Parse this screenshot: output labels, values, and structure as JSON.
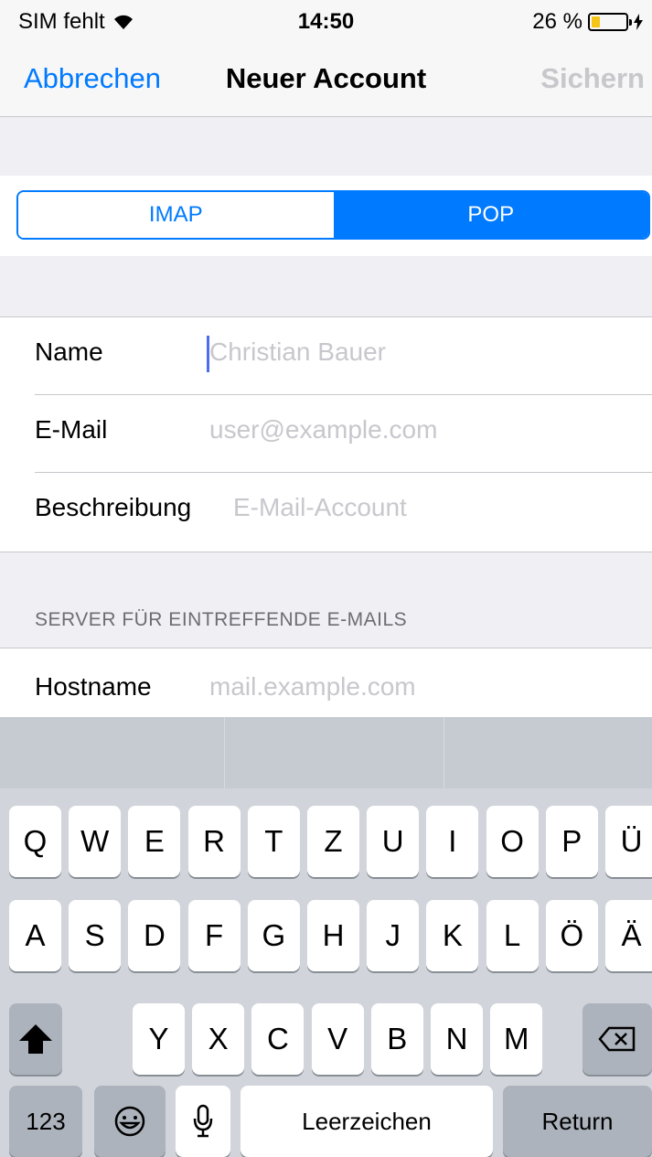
{
  "status": {
    "carrier": "SIM fehlt",
    "time": "14:50",
    "battery": "26 %",
    "battery_level": 0.26
  },
  "nav": {
    "cancel": "Abbrechen",
    "title": "Neuer Account",
    "save": "Sichern"
  },
  "segment": {
    "imap": "IMAP",
    "pop": "POP",
    "selected": "POP"
  },
  "form": {
    "name_label": "Name",
    "name_placeholder": "Christian Bauer",
    "email_label": "E-Mail",
    "email_placeholder": "user@example.com",
    "desc_label": "Beschreibung",
    "desc_placeholder": "E-Mail-Account"
  },
  "incoming": {
    "section_title": "SERVER FÜR EINTREFFENDE E-MAILS",
    "hostname_label": "Hostname",
    "hostname_placeholder": "mail.example.com"
  },
  "keyboard": {
    "row1": [
      "Q",
      "W",
      "E",
      "R",
      "T",
      "Z",
      "U",
      "I",
      "O",
      "P",
      "Ü"
    ],
    "row2": [
      "A",
      "S",
      "D",
      "F",
      "G",
      "H",
      "J",
      "K",
      "L",
      "Ö",
      "Ä"
    ],
    "row3": [
      "Y",
      "X",
      "C",
      "V",
      "B",
      "N",
      "M"
    ],
    "numbers": "123",
    "space": "Leerzeichen",
    "return": "Return"
  }
}
